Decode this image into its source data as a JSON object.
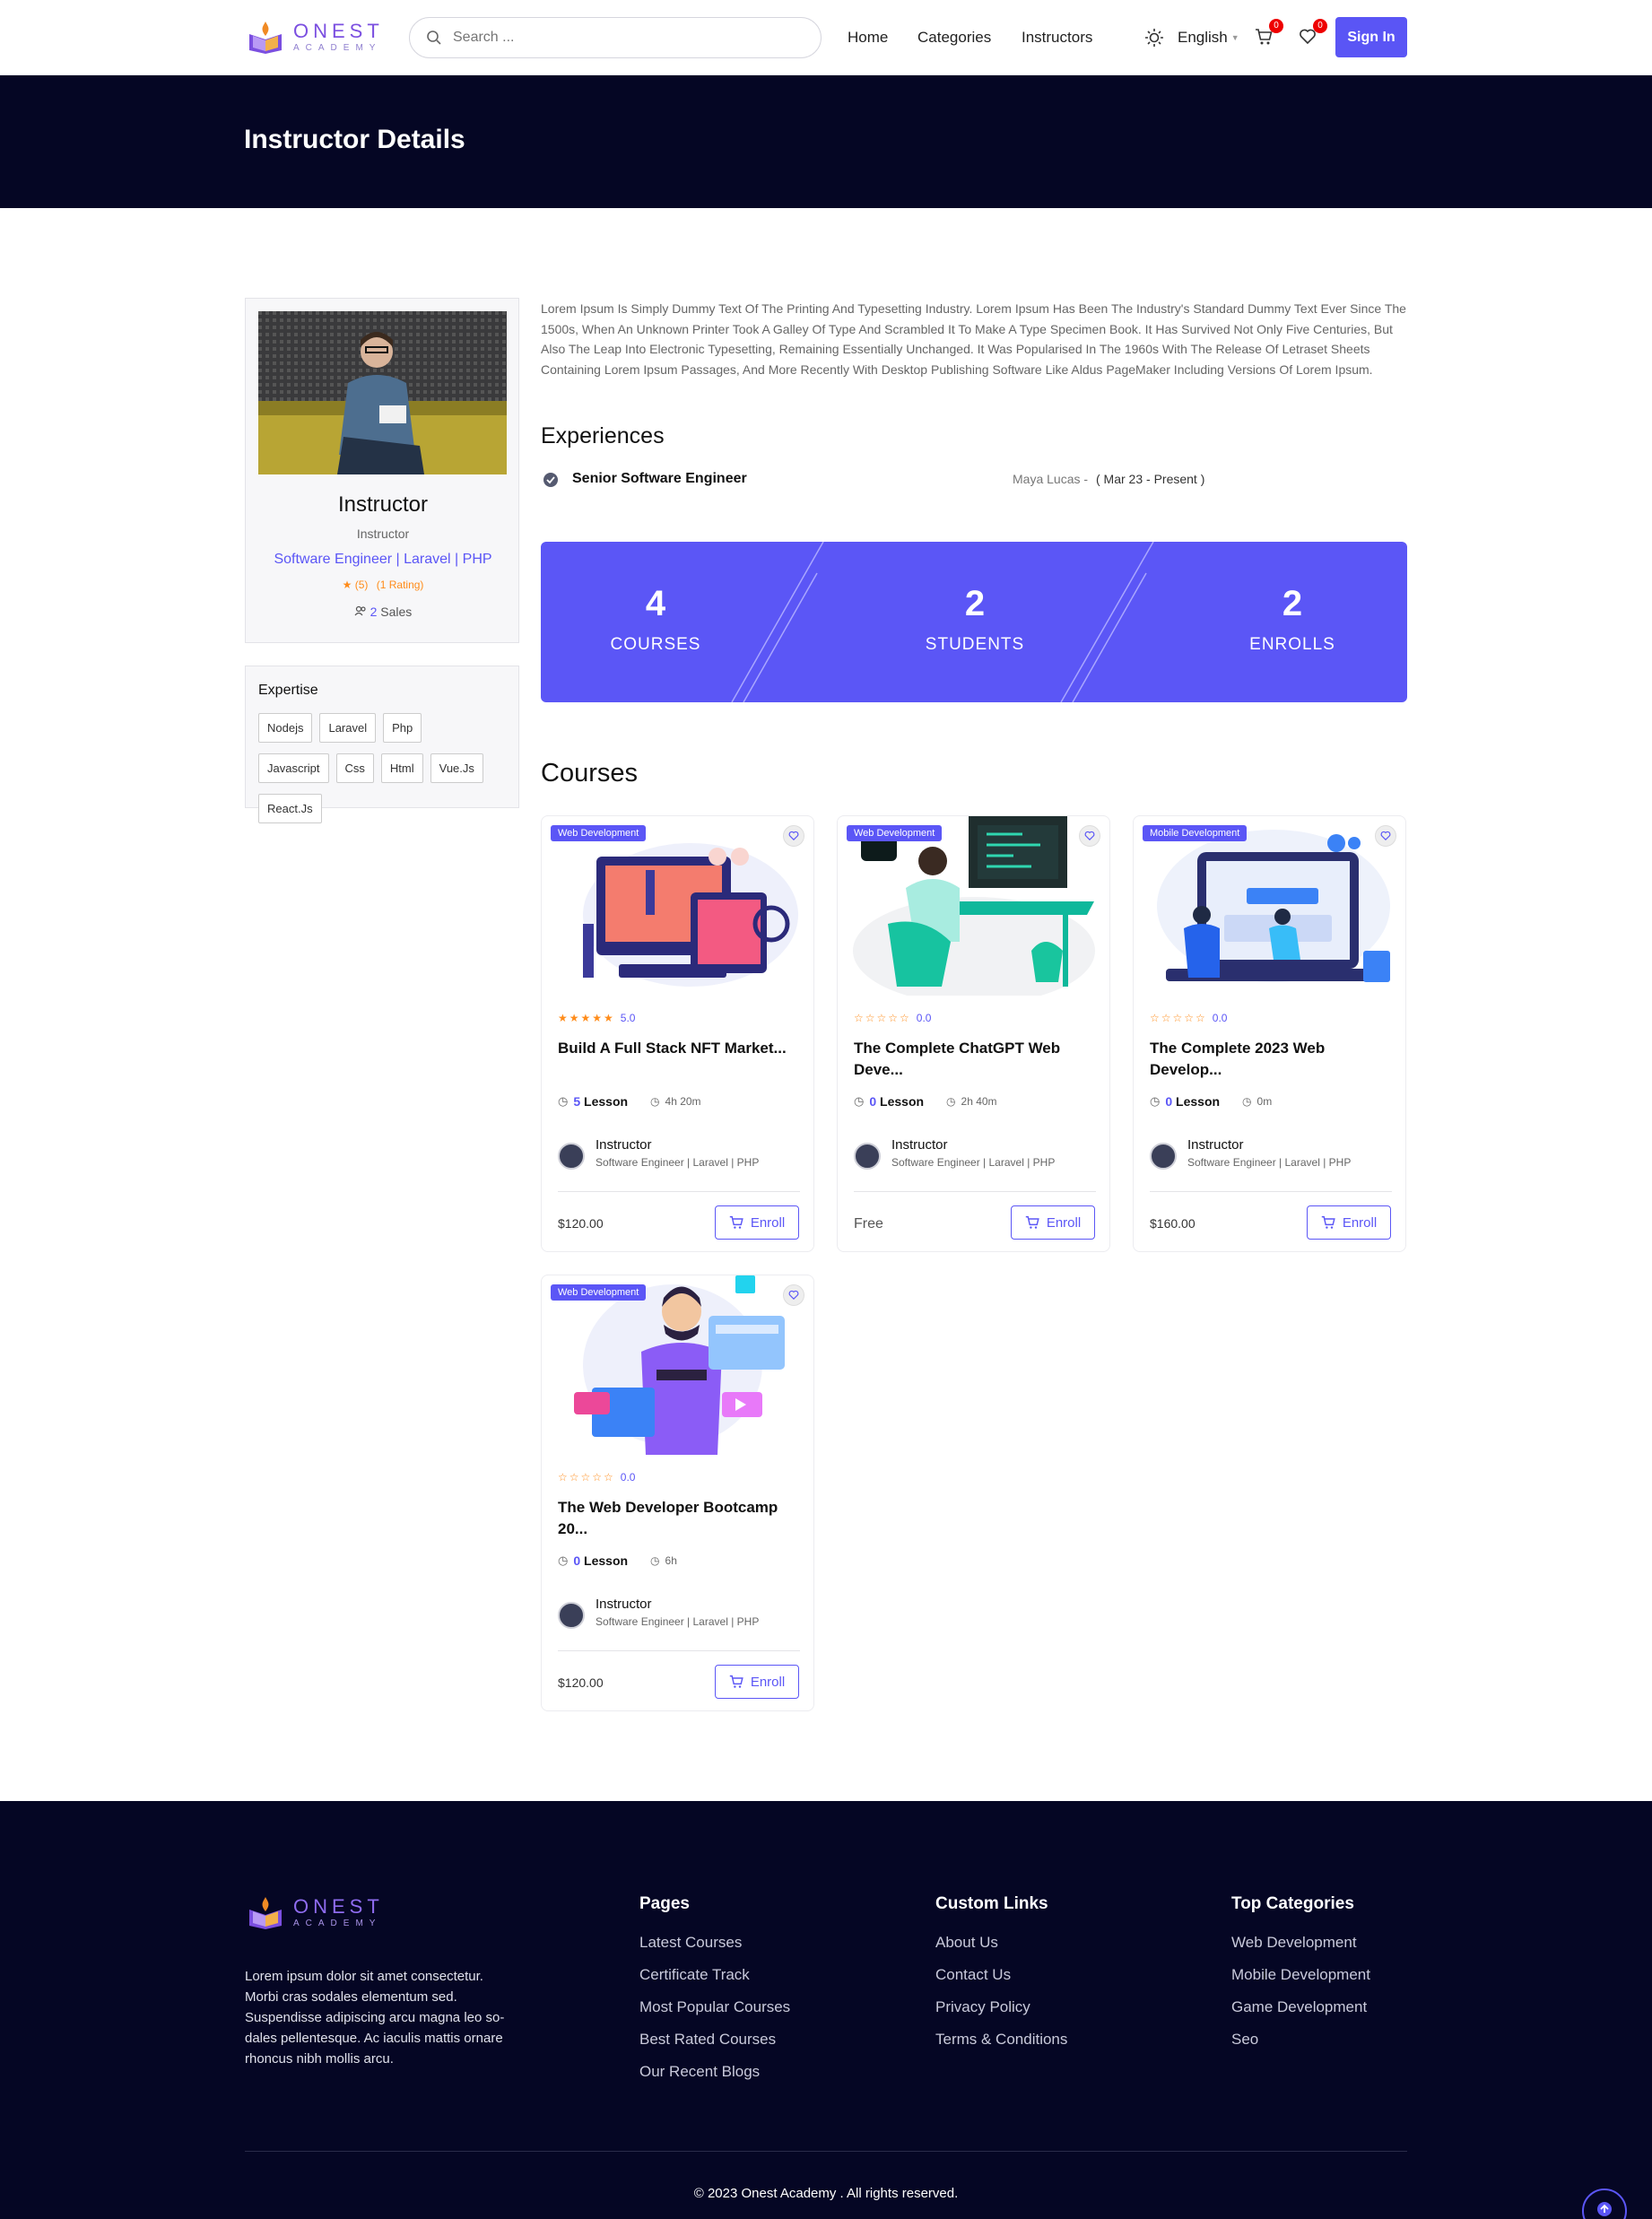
{
  "header": {
    "logo_main": "ONEST",
    "logo_sub": "ACADEMY",
    "search_placeholder": "Search ...",
    "nav": [
      "Home",
      "Categories",
      "Instructors"
    ],
    "language": "English",
    "cart_count": "0",
    "wishlist_count": "0",
    "signin_label": "Sign In"
  },
  "banner": {
    "title": "Instructor Details"
  },
  "profile": {
    "name": "Instructor",
    "role": "Instructor",
    "designation": "Software Engineer | Laravel | PHP",
    "rating_count": "(5)",
    "rating_text": "(1 Rating)",
    "sales_num": "2",
    "sales_label": "Sales"
  },
  "expertise": {
    "title": "Expertise",
    "tags": [
      "Nodejs",
      "Laravel",
      "Php",
      "Javascript",
      "Css",
      "Html",
      "Vue.Js",
      "React.Js"
    ]
  },
  "about": "Lorem Ipsum Is Simply Dummy Text Of The Printing And Typesetting Industry. Lorem Ipsum Has Been The Industry's Standard Dummy Text Ever Since The 1500s, When An Unknown Printer Took A Galley Of Type And Scrambled It To Make A Type Specimen Book. It Has Survived Not Only Five Centuries, But Also The Leap Into Electronic Typesetting, Remaining Essentially Unchanged. It Was Popularised In The 1960s With The Release Of Letraset Sheets Containing Lorem Ipsum Passages, And More Recently With Desktop Publishing Software Like Aldus PageMaker Including Versions Of Lorem Ipsum.",
  "experiences": {
    "title": "Experiences",
    "items": [
      {
        "position": "Senior Software Engineer",
        "company": "Maya Lucas -",
        "period": "( Mar 23 - Present )"
      }
    ]
  },
  "stats": [
    {
      "value": "4",
      "label": "COURSES"
    },
    {
      "value": "2",
      "label": "STUDENTS"
    },
    {
      "value": "2",
      "label": "ENROLLS"
    }
  ],
  "courses": {
    "title": "Courses",
    "items": [
      {
        "category": "Web Development",
        "rating": "5.0",
        "stars": 5,
        "title": "Build A Full Stack NFT Market...",
        "lessons": "5",
        "lesson_label": "Lesson",
        "duration": "4h 20m",
        "instructor": "Instructor",
        "instructor_role": "Software Engineer | Laravel | PHP",
        "price": "$120.00",
        "enroll_label": "Enroll"
      },
      {
        "category": "Web Development",
        "rating": "0.0",
        "stars": 0,
        "title": "The Complete ChatGPT Web Deve...",
        "lessons": "0",
        "lesson_label": "Lesson",
        "duration": "2h 40m",
        "instructor": "Instructor",
        "instructor_role": "Software Engineer | Laravel | PHP",
        "price": "Free",
        "enroll_label": "Enroll"
      },
      {
        "category": "Mobile Development",
        "rating": "0.0",
        "stars": 0,
        "title": "The Complete 2023 Web Develop...",
        "lessons": "0",
        "lesson_label": "Lesson",
        "duration": "0m",
        "instructor": "Instructor",
        "instructor_role": "Software Engineer | Laravel | PHP",
        "price": "$160.00",
        "enroll_label": "Enroll"
      },
      {
        "category": "Web Development",
        "rating": "0.0",
        "stars": 0,
        "title": "The Web Developer Bootcamp 20...",
        "lessons": "0",
        "lesson_label": "Lesson",
        "duration": "6h",
        "instructor": "Instructor",
        "instructor_role": "Software Engineer | Laravel | PHP",
        "price": "$120.00",
        "enroll_label": "Enroll"
      }
    ]
  },
  "footer": {
    "logo_main": "ONEST",
    "logo_sub": "ACADEMY",
    "about": "Lorem ipsum dolor sit amet consectetur. Morbi cras sodales elementum sed. Suspendisse adipiscing arcu magna leo so-dales pellentesque. Ac iaculis mattis ornare rhoncus nibh mollis arcu.",
    "pages": {
      "title": "Pages",
      "links": [
        "Latest Courses",
        "Certificate Track",
        "Most Popular Courses",
        "Best Rated Courses",
        "Our Recent Blogs"
      ]
    },
    "custom": {
      "title": "Custom Links",
      "links": [
        "About Us",
        "Contact Us",
        "Privacy Policy",
        "Terms & Conditions"
      ]
    },
    "categories": {
      "title": "Top Categories",
      "links": [
        "Web Development",
        "Mobile Development",
        "Game Development",
        "Seo"
      ]
    },
    "copyright": "© 2023 Onest Academy . All rights reserved."
  },
  "colors": {
    "accent": "#5b56f6",
    "dark": "#050624",
    "star": "#ff8c1a",
    "badge": "#e00000"
  }
}
